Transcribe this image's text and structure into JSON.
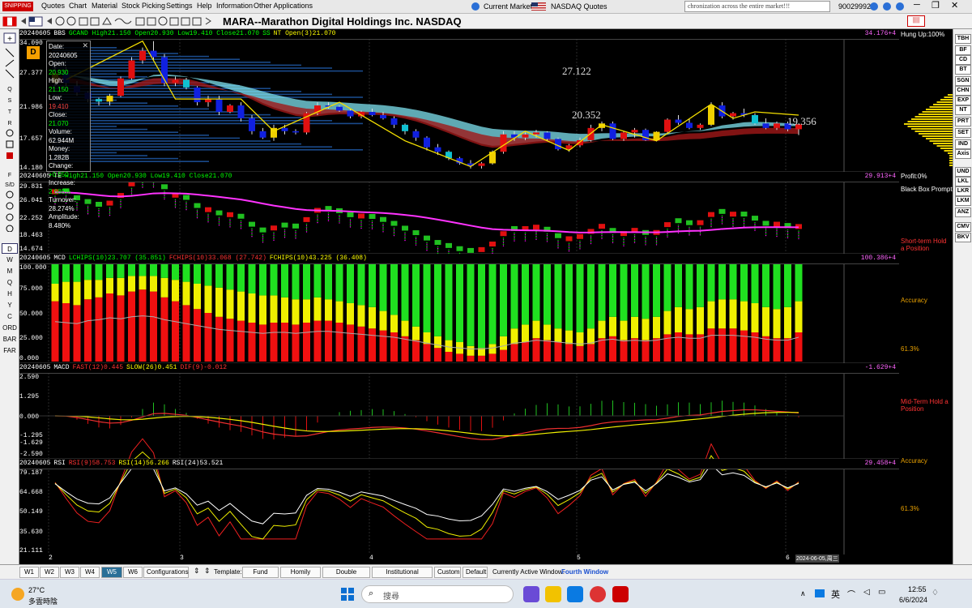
{
  "app_logo": "SNIPPING",
  "menu": [
    "Quotes",
    "Chart",
    "Material",
    "Stock Picking",
    "Settings",
    "Help",
    "Information",
    "Other Applications"
  ],
  "market": {
    "current_label": "Current Market",
    "quotes_label": "NASDAQ Quotes"
  },
  "ticker_msg": "chronization across the entire market!!!",
  "account": "90029992",
  "title": "MARA--Marathon Digital Holdings Inc.  NASDAQ",
  "panel1": {
    "date": "20240605",
    "label": "BBS",
    "ind": "GCAND High21.150 Open20.930 Low19.410 Close21.070",
    "ss": "SS",
    "nt": "NT Open(3)21.070",
    "rv": "34.176+4",
    "y": [
      "34.090",
      "27.377",
      "21.986",
      "17.657",
      "14.180"
    ],
    "ann": [
      "27.122",
      "20.352",
      "19.356"
    ]
  },
  "panel2": {
    "date": "20240605",
    "label": "TE",
    "ind": "High21.150 Open20.930 Low19.410 Close21.070",
    "rv": "29.913+4",
    "y": [
      "29.831",
      "26.041",
      "22.252",
      "18.463",
      "14.674"
    ]
  },
  "panel3": {
    "date": "20240605",
    "label": "MCD",
    "l1": "LCHIPS(10)23.707 (35.851)",
    "l2": "FCHIPS(10)33.068 (27.742)",
    "l3": "FCHIPS(10)43.225 (36.408)",
    "rv": "100.386+4",
    "y": [
      "100.000",
      "75.000",
      "50.000",
      "25.000",
      "0.000"
    ]
  },
  "panel4": {
    "date": "20240605",
    "label": "MACD",
    "fast": "FAST(12)0.445",
    "slow": "SLOW(26)0.451",
    "dif": "DIF(9)-0.012",
    "rv": "-1.629+4",
    "y": [
      "2.590",
      "1.295",
      "0.000",
      "-1.295",
      "-1.629",
      "-2.590"
    ]
  },
  "panel5": {
    "date": "20240605",
    "label": "RSI",
    "r1": "RSI(9)58.753",
    "r2": "RSI(14)56.266",
    "r3": "RSI(24)53.521",
    "rv": "29.458+4",
    "y": [
      "79.187",
      "64.668",
      "50.149",
      "35.630",
      "21.111"
    ]
  },
  "side": {
    "hung": "Hung Up:100%",
    "profit": "Profit:0%",
    "bbp": "Black Box Prompt",
    "short": "Short-term Hold a Position",
    "acc1": "Accuracy",
    "pct1": "61.3%",
    "mid": "Mid-Term Hold a Position",
    "acc2": "Accuracy",
    "pct2": "61.3%"
  },
  "popup": [
    [
      "Date:",
      "20240605",
      "#fff"
    ],
    [
      "Open:",
      "20.930",
      "#0f0"
    ],
    [
      "High:",
      "21.150",
      "#0f0"
    ],
    [
      "Low:",
      "19.410",
      "#f44"
    ],
    [
      "Close:",
      "21.070",
      "#0f0"
    ],
    [
      "Volume:",
      "62.944M",
      "#fff"
    ],
    [
      "Money:",
      "1.282B",
      "#fff"
    ],
    [
      "Change:",
      "+0.550",
      "#0f0"
    ],
    [
      "Increase:",
      "2.680%",
      "#0f0"
    ],
    [
      "Turnover:",
      "28.274%",
      "#fff"
    ],
    [
      "Amplitude:",
      "8.480%",
      "#fff"
    ]
  ],
  "xaxis": [
    "2",
    "3",
    "4",
    "5",
    "6"
  ],
  "date_label": "2024-06-05,周三",
  "left_buttons": [
    "D",
    "W",
    "M",
    "Q",
    "H",
    "Y",
    "C",
    "ORD",
    "BAR",
    "FAR"
  ],
  "right_buttons": [
    "TBH",
    "BF",
    "CD",
    "BT",
    "SGN",
    "CHN",
    "EXP",
    "NT",
    "PRT",
    "SET",
    "IND",
    "Axis",
    "UND",
    "LKL",
    "LKR",
    "LKM",
    "ANZ",
    "CMV",
    "BKV"
  ],
  "tabs": [
    "W1",
    "W2",
    "W3",
    "W4",
    "W5",
    "W6",
    "Configurations"
  ],
  "template_label": "Template:",
  "templates": [
    "Fund Trend",
    "Homily Wave",
    "Double Swords",
    "Institutional Arbitrage",
    "Custom",
    "Default"
  ],
  "active_window_label": "Currently Active Window:",
  "active_window": "Fourth Window",
  "weather": {
    "temp": "27°C",
    "desc": "多雲時陰"
  },
  "search": "搜尋",
  "clock": {
    "time": "12:55",
    "date": "6/6/2024"
  },
  "ime": "英",
  "candles": [
    [
      27.5,
      30.5,
      27,
      29
    ],
    [
      29,
      30,
      27,
      27.5
    ],
    [
      27,
      27.8,
      25.5,
      26
    ],
    [
      26,
      26.2,
      24.5,
      25
    ],
    [
      25,
      25.2,
      24,
      24.6
    ],
    [
      24.6,
      25.8,
      24,
      25.5
    ],
    [
      25.5,
      28.5,
      25.3,
      28.2
    ],
    [
      28.2,
      31.5,
      28,
      31
    ],
    [
      31,
      33,
      30.5,
      32.5
    ],
    [
      32.5,
      34,
      31,
      31.5
    ],
    [
      31.5,
      32,
      27,
      27.5
    ],
    [
      27.5,
      28.5,
      27,
      28
    ],
    [
      28,
      28.3,
      26.5,
      26.8
    ],
    [
      26.8,
      27,
      24,
      24.5
    ],
    [
      24.5,
      25.5,
      23.8,
      25
    ],
    [
      25,
      25.5,
      22.5,
      23
    ],
    [
      23,
      24.2,
      22.8,
      24
    ],
    [
      24,
      24.5,
      21.5,
      22
    ],
    [
      22,
      22.5,
      19.5,
      20
    ],
    [
      20,
      20.5,
      18.8,
      19
    ],
    [
      19,
      21,
      18.5,
      20.5
    ],
    [
      20.5,
      21,
      19.5,
      20
    ],
    [
      20,
      20.3,
      19.5,
      19.8
    ],
    [
      19.8,
      23,
      19.5,
      22.8
    ],
    [
      22.8,
      24.5,
      22.5,
      24
    ],
    [
      24,
      24.5,
      23.5,
      23.8
    ],
    [
      23.8,
      24,
      23,
      23.2
    ],
    [
      23.2,
      23.5,
      22,
      22.3
    ],
    [
      22.3,
      23.2,
      22,
      23
    ],
    [
      23,
      23.5,
      22.3,
      22.5
    ],
    [
      22.5,
      23,
      21.8,
      22
    ],
    [
      22,
      22.3,
      20.5,
      21
    ],
    [
      21,
      21.2,
      19.5,
      20
    ],
    [
      20,
      20.3,
      18.5,
      19
    ],
    [
      19,
      19.2,
      17,
      17.5
    ],
    [
      17.5,
      18,
      16.3,
      16.8
    ],
    [
      16.8,
      17,
      15.5,
      15.8
    ],
    [
      15.8,
      16,
      14.8,
      15
    ],
    [
      15,
      15.5,
      14.2,
      14.6
    ],
    [
      14.6,
      15.2,
      14.2,
      15
    ],
    [
      15,
      17,
      14.8,
      16.8
    ],
    [
      16.8,
      20,
      16.5,
      19.5
    ],
    [
      19.5,
      20,
      18.5,
      19
    ],
    [
      19,
      19.8,
      18.6,
      19.5
    ],
    [
      19.5,
      20.2,
      19,
      19.8
    ],
    [
      19.8,
      20,
      18.5,
      18.8
    ],
    [
      18.8,
      19,
      17,
      17.2
    ],
    [
      17.2,
      18,
      16.8,
      17.8
    ],
    [
      17.8,
      19,
      17.5,
      18.6
    ],
    [
      18.6,
      21,
      18.4,
      20.5
    ],
    [
      20.5,
      21.5,
      20,
      21.2
    ],
    [
      21.2,
      21.5,
      18.6,
      18.8
    ],
    [
      18.8,
      20,
      18.5,
      19.8
    ],
    [
      19.8,
      20.5,
      19,
      20.2
    ],
    [
      20.2,
      20.4,
      18.5,
      18.6
    ],
    [
      18.6,
      20,
      18.4,
      19.9
    ],
    [
      19.9,
      22,
      19.7,
      21.8
    ],
    [
      21.8,
      22.5,
      21,
      21.3
    ],
    [
      21.3,
      22,
      20.3,
      20.5
    ],
    [
      20.5,
      21.2,
      20.2,
      21
    ],
    [
      21,
      24.5,
      20.8,
      24
    ],
    [
      24,
      24.5,
      22,
      22.3
    ],
    [
      22.3,
      23,
      21.8,
      22.8
    ],
    [
      22.8,
      23.5,
      22.2,
      22.5
    ],
    [
      22.5,
      22.8,
      21,
      21.2
    ],
    [
      21.2,
      22,
      20.3,
      20.5
    ],
    [
      20.5,
      21.5,
      20.2,
      21.2
    ],
    [
      21.2,
      21.5,
      20,
      20.3
    ],
    [
      20.3,
      21.2,
      19.4,
      21.07
    ]
  ],
  "bars3": [
    [
      62,
      18,
      20
    ],
    [
      60,
      22,
      18
    ],
    [
      58,
      24,
      18
    ],
    [
      64,
      20,
      16
    ],
    [
      66,
      18,
      16
    ],
    [
      70,
      16,
      14
    ],
    [
      68,
      18,
      14
    ],
    [
      72,
      16,
      12
    ],
    [
      74,
      14,
      12
    ],
    [
      72,
      16,
      12
    ],
    [
      66,
      20,
      14
    ],
    [
      62,
      22,
      16
    ],
    [
      58,
      24,
      18
    ],
    [
      54,
      26,
      20
    ],
    [
      50,
      28,
      22
    ],
    [
      46,
      30,
      24
    ],
    [
      44,
      30,
      26
    ],
    [
      42,
      30,
      28
    ],
    [
      40,
      30,
      30
    ],
    [
      38,
      30,
      32
    ],
    [
      40,
      28,
      32
    ],
    [
      40,
      26,
      34
    ],
    [
      38,
      26,
      36
    ],
    [
      40,
      24,
      36
    ],
    [
      42,
      24,
      34
    ],
    [
      42,
      22,
      36
    ],
    [
      40,
      22,
      38
    ],
    [
      38,
      22,
      40
    ],
    [
      36,
      22,
      42
    ],
    [
      34,
      22,
      44
    ],
    [
      32,
      20,
      48
    ],
    [
      30,
      18,
      52
    ],
    [
      26,
      16,
      58
    ],
    [
      22,
      14,
      64
    ],
    [
      18,
      12,
      70
    ],
    [
      14,
      12,
      74
    ],
    [
      10,
      12,
      78
    ],
    [
      8,
      12,
      80
    ],
    [
      6,
      10,
      84
    ],
    [
      6,
      8,
      86
    ],
    [
      8,
      10,
      82
    ],
    [
      12,
      14,
      74
    ],
    [
      18,
      16,
      66
    ],
    [
      20,
      18,
      62
    ],
    [
      24,
      18,
      58
    ],
    [
      22,
      16,
      62
    ],
    [
      20,
      14,
      66
    ],
    [
      18,
      14,
      68
    ],
    [
      16,
      14,
      70
    ],
    [
      18,
      16,
      66
    ],
    [
      24,
      18,
      58
    ],
    [
      26,
      20,
      54
    ],
    [
      22,
      20,
      58
    ],
    [
      24,
      22,
      54
    ],
    [
      22,
      22,
      56
    ],
    [
      24,
      22,
      54
    ],
    [
      28,
      24,
      48
    ],
    [
      30,
      26,
      44
    ],
    [
      28,
      26,
      46
    ],
    [
      28,
      28,
      44
    ],
    [
      34,
      28,
      38
    ],
    [
      34,
      30,
      36
    ],
    [
      34,
      30,
      36
    ],
    [
      32,
      30,
      38
    ],
    [
      30,
      30,
      40
    ],
    [
      26,
      30,
      44
    ],
    [
      24,
      30,
      46
    ],
    [
      24,
      32,
      44
    ],
    [
      30,
      32,
      38
    ]
  ]
}
